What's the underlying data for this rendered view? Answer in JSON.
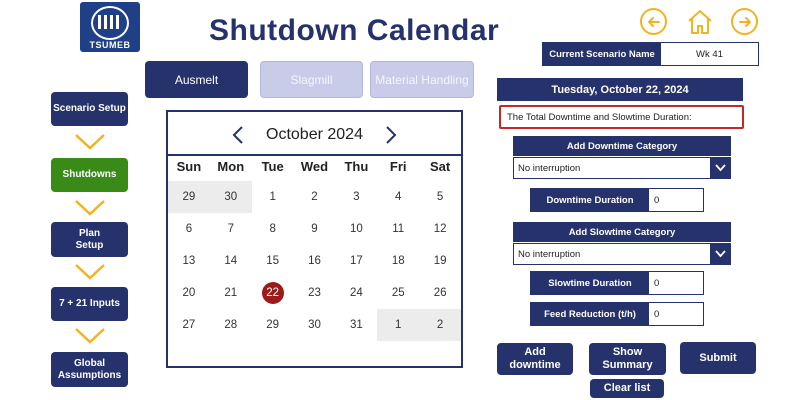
{
  "logo": {
    "text": "TSUMEB"
  },
  "header": {
    "title": "Shutdown  Calendar"
  },
  "nav": {
    "icons": [
      "arrow-left-icon",
      "home-icon",
      "arrow-right-icon"
    ],
    "accent": "#f0b323"
  },
  "scenario": {
    "label": "Current Scenario Name",
    "value": "Wk 41"
  },
  "tabs": [
    {
      "label": "Ausmelt",
      "active": true
    },
    {
      "label": "Slagmill",
      "active": false
    },
    {
      "label": "Material Handling",
      "active": false
    }
  ],
  "workflow": [
    {
      "label": "Scenario Setup"
    },
    {
      "label": "Shutdowns",
      "active": true
    },
    {
      "label": "Plan Setup"
    },
    {
      "label": "7 + 21 Inputs"
    },
    {
      "label": "Global Assumptions"
    }
  ],
  "calendar": {
    "month_label": "October 2024",
    "weekdays": [
      "Sun",
      "Mon",
      "Tue",
      "Wed",
      "Thu",
      "Fri",
      "Sat"
    ],
    "weeks": [
      [
        {
          "d": "29",
          "other": true
        },
        {
          "d": "30",
          "other": true
        },
        {
          "d": "1"
        },
        {
          "d": "2"
        },
        {
          "d": "3"
        },
        {
          "d": "4"
        },
        {
          "d": "5"
        }
      ],
      [
        {
          "d": "6"
        },
        {
          "d": "7"
        },
        {
          "d": "8"
        },
        {
          "d": "9"
        },
        {
          "d": "10"
        },
        {
          "d": "11"
        },
        {
          "d": "12"
        }
      ],
      [
        {
          "d": "13"
        },
        {
          "d": "14"
        },
        {
          "d": "15"
        },
        {
          "d": "16"
        },
        {
          "d": "17"
        },
        {
          "d": "18"
        },
        {
          "d": "19"
        }
      ],
      [
        {
          "d": "20"
        },
        {
          "d": "21"
        },
        {
          "d": "22",
          "selected": true
        },
        {
          "d": "23"
        },
        {
          "d": "24"
        },
        {
          "d": "25"
        },
        {
          "d": "26"
        }
      ],
      [
        {
          "d": "27"
        },
        {
          "d": "28"
        },
        {
          "d": "29"
        },
        {
          "d": "30"
        },
        {
          "d": "31"
        },
        {
          "d": "1",
          "other": true
        },
        {
          "d": "2",
          "other": true
        }
      ]
    ],
    "selected_color": "#9b1b1b"
  },
  "details": {
    "date": "Tuesday, October 22, 2024",
    "total_text": "The Total Downtime and Slowtime Duration:",
    "downtime_category_label": "Add Downtime Category",
    "downtime_category_value": "No interruption",
    "downtime_duration_label": "Downtime Duration",
    "downtime_duration_value": "0",
    "slowtime_category_label": "Add Slowtime Category",
    "slowtime_category_value": "No interruption",
    "slowtime_duration_label": "Slowtime Duration",
    "slowtime_duration_value": "0",
    "feed_reduction_label": "Feed Reduction (t/h)",
    "feed_reduction_value": "0"
  },
  "actions": {
    "add_downtime": "Add downtime",
    "show_summary": "Show Summary",
    "submit": "Submit",
    "clear_list": "Clear list"
  },
  "colors": {
    "primary": "#25326b",
    "success": "#3a8a17",
    "alert": "#c22a2a"
  }
}
